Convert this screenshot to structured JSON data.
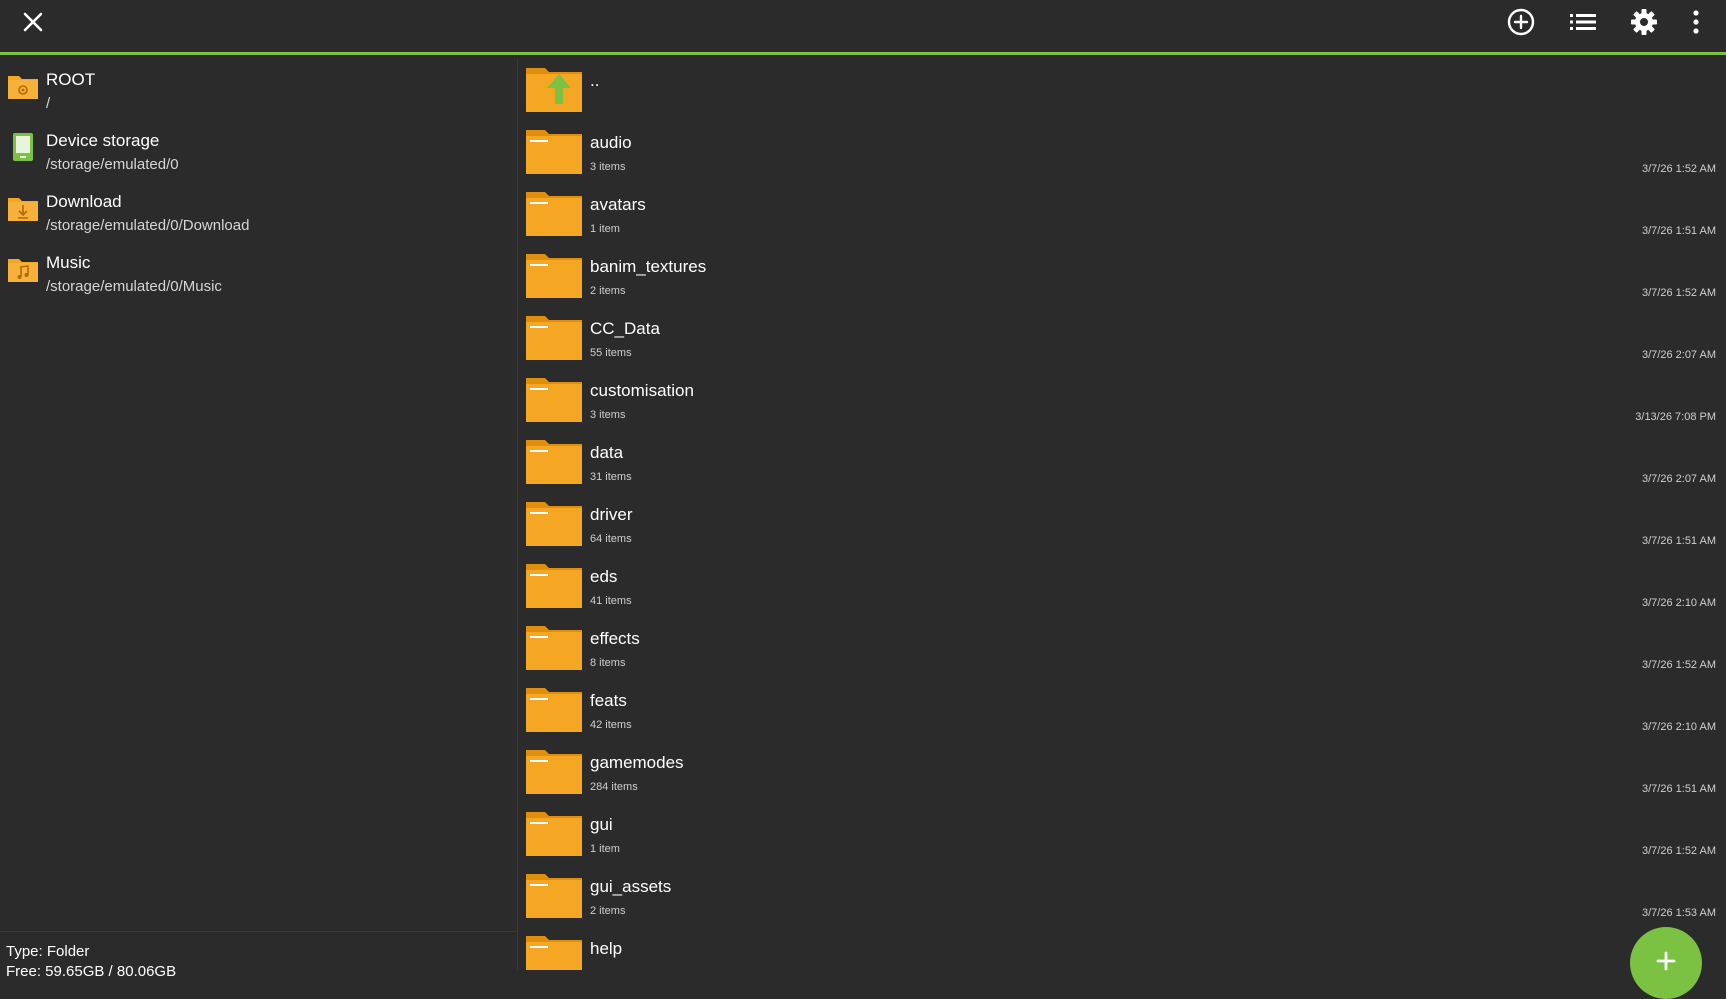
{
  "colors": {
    "accent": "#7bc142",
    "folder": "#f5a623",
    "folder_tab": "#e08e0b",
    "background": "#2b2b2b"
  },
  "toolbar": {
    "close_icon": "close-icon",
    "add_icon": "plus-circle-icon",
    "list_icon": "list-view-icon",
    "settings_icon": "gear-icon",
    "more_icon": "more-vertical-icon"
  },
  "bookmarks": [
    {
      "name": "ROOT",
      "path": "/",
      "icon": "root-folder-icon"
    },
    {
      "name": "Device storage",
      "path": "/storage/emulated/0",
      "icon": "device-storage-icon"
    },
    {
      "name": "Download",
      "path": "/storage/emulated/0/Download",
      "icon": "download-folder-icon"
    },
    {
      "name": "Music",
      "path": "/storage/emulated/0/Music",
      "icon": "music-folder-icon"
    }
  ],
  "status": {
    "type": "Type: Folder",
    "free": "Free: 59.65GB / 80.06GB"
  },
  "parent": {
    "name": ".."
  },
  "files": [
    {
      "name": "audio",
      "count": "3 items",
      "date": "3/7/26 1:52 AM"
    },
    {
      "name": "avatars",
      "count": "1 item",
      "date": "3/7/26 1:51 AM"
    },
    {
      "name": "banim_textures",
      "count": "2 items",
      "date": "3/7/26 1:52 AM"
    },
    {
      "name": "CC_Data",
      "count": "55 items",
      "date": "3/7/26 2:07 AM"
    },
    {
      "name": "customisation",
      "count": "3 items",
      "date": "3/13/26 7:08 PM"
    },
    {
      "name": "data",
      "count": "31 items",
      "date": "3/7/26 2:07 AM"
    },
    {
      "name": "driver",
      "count": "64 items",
      "date": "3/7/26 1:51 AM"
    },
    {
      "name": "eds",
      "count": "41 items",
      "date": "3/7/26 2:10 AM"
    },
    {
      "name": "effects",
      "count": "8 items",
      "date": "3/7/26 1:52 AM"
    },
    {
      "name": "feats",
      "count": "42 items",
      "date": "3/7/26 2:10 AM"
    },
    {
      "name": "gamemodes",
      "count": "284 items",
      "date": "3/7/26 1:51 AM"
    },
    {
      "name": "gui",
      "count": "1 item",
      "date": "3/7/26 1:52 AM"
    },
    {
      "name": "gui_assets",
      "count": "2 items",
      "date": "3/7/26 1:53 AM"
    },
    {
      "name": "help",
      "count": "",
      "date": ""
    }
  ],
  "fab": {
    "icon": "plus-icon"
  }
}
